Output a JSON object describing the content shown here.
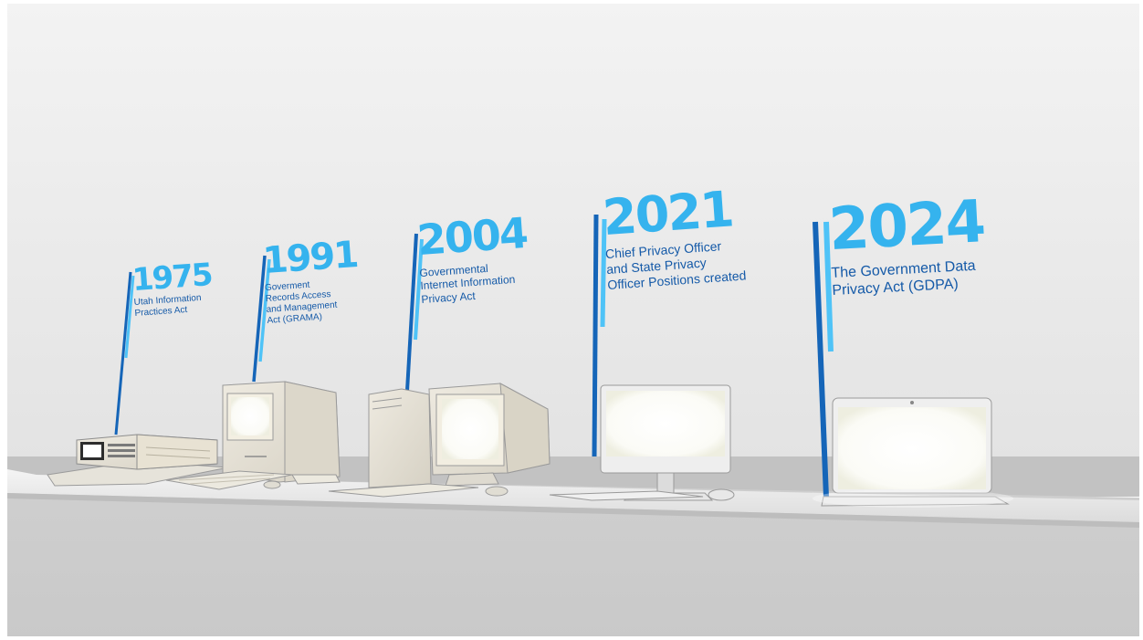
{
  "timeline": {
    "milestones": [
      {
        "year": "1975",
        "lines": [
          "Utah Information",
          "Practices Act"
        ]
      },
      {
        "year": "1991",
        "lines": [
          "Goverment",
          "Records Access",
          "and Management",
          "Act (GRAMA)"
        ]
      },
      {
        "year": "2004",
        "lines": [
          "Governmental",
          "Internet Information",
          "Privacy Act"
        ]
      },
      {
        "year": "2021",
        "lines": [
          "Chief Privacy Officer",
          "and State Privacy",
          "Officer Positions created"
        ]
      },
      {
        "year": "2024",
        "lines": [
          "The Government Data",
          "Privacy Act (GDPA)"
        ]
      }
    ]
  },
  "colors": {
    "year_text": "#35b3ee",
    "caption_text": "#155aa8",
    "pole_dark": "#1565b8",
    "pole_light": "#4fc3f7",
    "wall": "#e9e9e9",
    "floor": "#cfcfcf"
  },
  "icons": {
    "m1975": "retro-terminal-icon",
    "m1991": "compact-computer-icon",
    "m2004": "tower-pc-crt-icon",
    "m2021": "imac-monitor-icon",
    "m2024": "laptop-icon"
  }
}
